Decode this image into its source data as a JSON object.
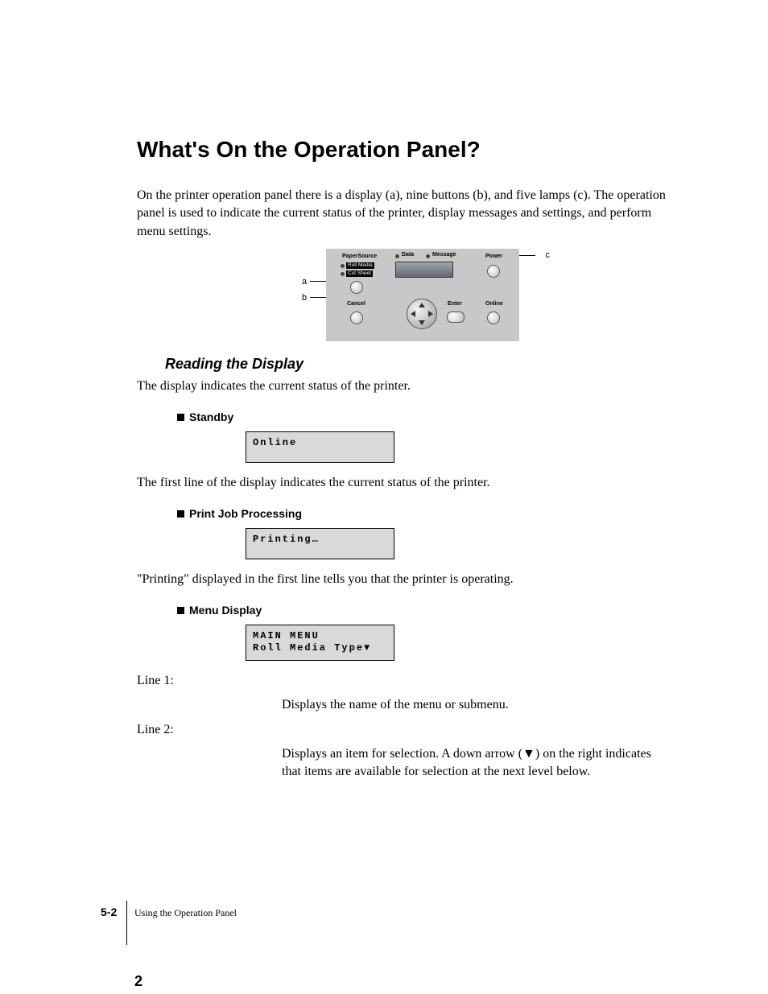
{
  "title": "What's On the Operation Panel?",
  "intro": "On the printer operation panel there is a display (a), nine buttons (b), and five lamps (c). The operation panel is used to indicate the current status of the printer, display messages and settings, and perform menu settings.",
  "diagram": {
    "callouts": {
      "a": "a",
      "b": "b",
      "c": "c"
    },
    "labels": {
      "paperSource": "PaperSource",
      "rollMedia": "Roll Media",
      "cutSheet": "Cut Sheet",
      "data": "Data",
      "message": "Message",
      "power": "Power",
      "cancel": "Cancel",
      "enter": "Enter",
      "online": "Online"
    }
  },
  "section": {
    "heading": "Reading the Display",
    "intro": "The display indicates the current status of the printer.",
    "standby": {
      "title": "Standby",
      "lcd": "Online",
      "desc": "The first line of the display indicates the current status of the printer."
    },
    "processing": {
      "title": "Print Job Processing",
      "lcd": "Printing…",
      "desc": "\"Printing\" displayed in the first line tells you that the printer is operating."
    },
    "menu": {
      "title": "Menu Display",
      "lcd_line1": "MAIN MENU",
      "lcd_line2": "Roll Media Type▼",
      "line1_label": "Line 1:",
      "line1_desc": "Displays the name of the menu or submenu.",
      "line2_label": "Line 2:",
      "line2_desc": "Displays an item for selection. A down arrow (▼) on the right indicates that items are available for selection at the next level below."
    }
  },
  "footer": {
    "page_number": "5-2",
    "chapter": "Using the Operation Panel",
    "big": "2"
  }
}
